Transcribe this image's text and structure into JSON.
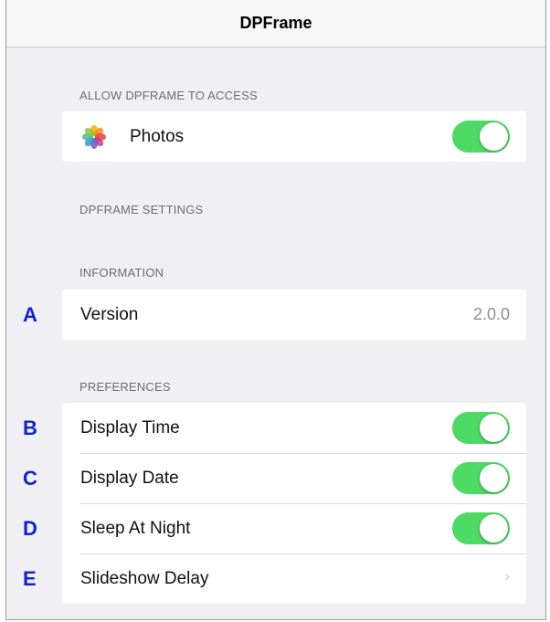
{
  "nav": {
    "title": "DPFrame"
  },
  "access": {
    "header": "ALLOW DPFRAME TO ACCESS",
    "photos": {
      "label": "Photos",
      "enabled": true,
      "icon": "photos-app-icon"
    }
  },
  "settings_header": "DPFRAME SETTINGS",
  "information": {
    "header": "INFORMATION",
    "version": {
      "label": "Version",
      "value": "2.0.0"
    }
  },
  "preferences": {
    "header": "PREFERENCES",
    "items": [
      {
        "label": "Display Time",
        "type": "toggle",
        "enabled": true
      },
      {
        "label": "Display Date",
        "type": "toggle",
        "enabled": true
      },
      {
        "label": "Sleep At Night",
        "type": "toggle",
        "enabled": true
      },
      {
        "label": "Slideshow Delay",
        "type": "disclosure",
        "chevron": "›"
      }
    ]
  },
  "annotations": [
    "A",
    "B",
    "C",
    "D",
    "E"
  ],
  "colors": {
    "toggle_on": "#4cd964",
    "annotation": "#1323c9",
    "background": "#efeff4"
  }
}
